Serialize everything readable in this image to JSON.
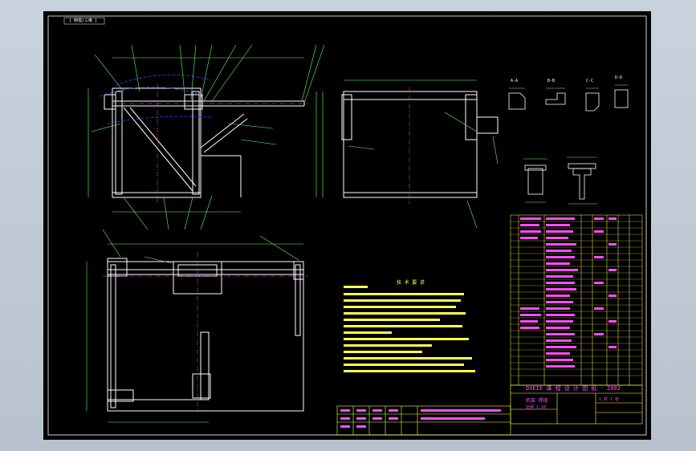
{
  "drawing": {
    "sheet_tag": "[ 俯视/三维 ]",
    "notes_title": "技 术 要 求",
    "title_block": {
      "school": "DXEIE  课 程 设 计 图 纸 - 2002",
      "part_name": "机架 焊接",
      "scale": "比例 1:10",
      "sheet": "1 共 1 张"
    },
    "section_labels": [
      "A-A",
      "B-B",
      "C-C",
      "D-D"
    ]
  },
  "colors": {
    "background": "#000000",
    "frame": "#ffffff",
    "outline": "#ffffff",
    "dimension": "#66ff66",
    "text": "#ff4dff",
    "hidden": "#3a3aff",
    "center": "#ff3dff",
    "notes": "#ffff4d"
  }
}
